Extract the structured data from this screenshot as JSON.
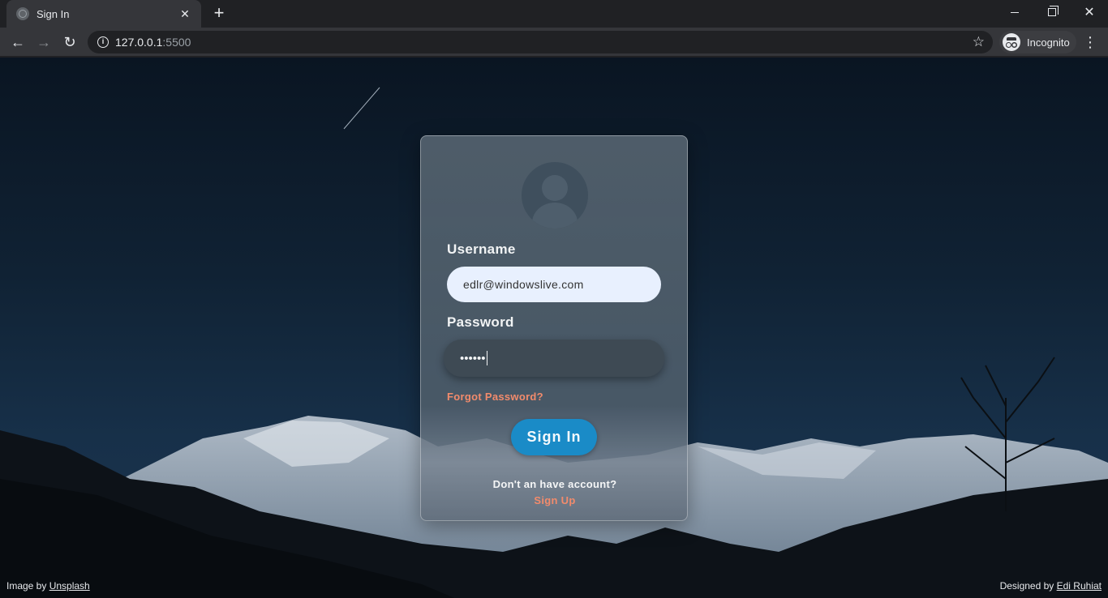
{
  "browser": {
    "tab_title": "Sign In",
    "tab_close": "✕",
    "new_tab": "+",
    "url_host": "127.0.0.1",
    "url_port": ":5500",
    "profile_label": "Incognito",
    "window_close": "✕",
    "back": "←",
    "forward": "→",
    "reload": "↻",
    "star": "☆",
    "menu": "⋮"
  },
  "form": {
    "username_label": "Username",
    "username_value": "edlr@windowslive.com",
    "password_label": "Password",
    "password_masked": "••••••",
    "forgot_password": "Forgot Password?",
    "signin_button": "Sign In",
    "no_account_text": "Don't an have account?",
    "signup_link": "Sign Up"
  },
  "footer": {
    "image_by_prefix": "Image by ",
    "image_by_link": "Unsplash",
    "designed_by_prefix": "Designed by ",
    "designed_by_link": "Edi Ruhiat"
  },
  "colors": {
    "accent_button": "#1a8bc7",
    "link_color": "#f28b6c",
    "input_fill": "#e8f0fe"
  },
  "icons": [
    "globe-icon",
    "close-icon",
    "plus-icon",
    "back-arrow-icon",
    "forward-arrow-icon",
    "reload-icon",
    "info-icon",
    "star-icon",
    "incognito-icon",
    "more-vert-icon",
    "avatar-icon"
  ]
}
